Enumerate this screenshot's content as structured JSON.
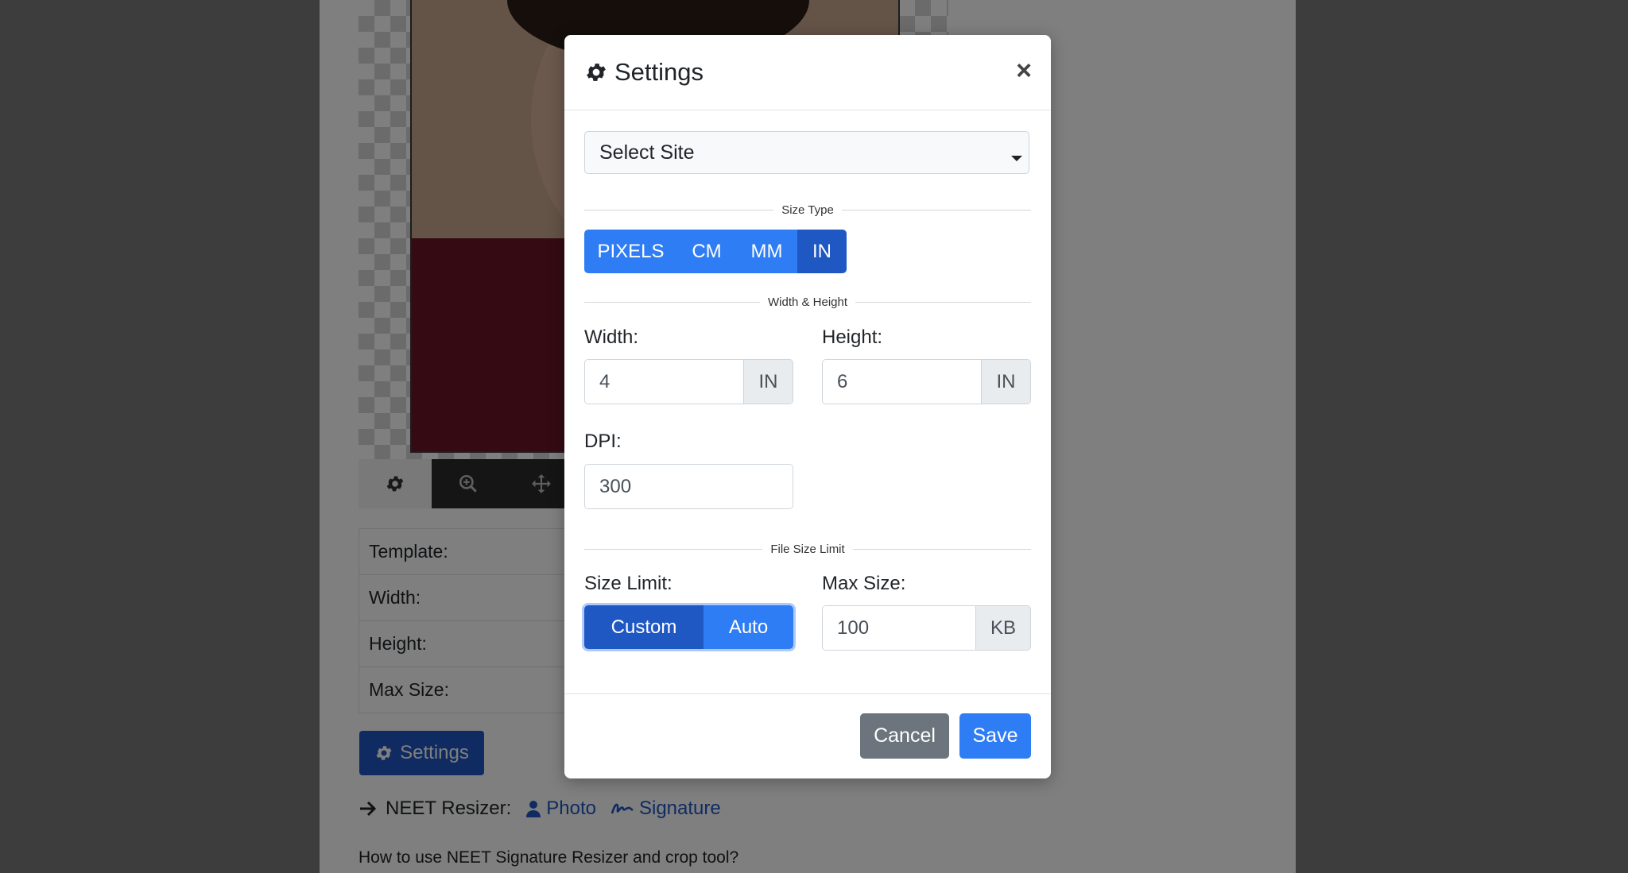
{
  "background": {
    "toolbar_tools": [
      "gear-icon",
      "zoom-in-icon",
      "move-icon"
    ],
    "info_rows": [
      "Template:",
      "Width:",
      "Height:",
      "Max Size:"
    ],
    "settings_button": "Settings",
    "resizer_prefix": "NEET Resizer:",
    "photo_link": "Photo",
    "signature_link": "Signature",
    "howto_text": "How to use NEET Signature Resizer and crop tool?"
  },
  "modal": {
    "title": "Settings",
    "close": "×",
    "select_site": "Select Site",
    "size_type_label": "Size Type",
    "size_types": [
      "PIXELS",
      "CM",
      "MM",
      "IN"
    ],
    "size_type_selected": "IN",
    "width_height_label": "Width & Height",
    "width_label": "Width:",
    "width_value": "4",
    "width_unit": "IN",
    "height_label": "Height:",
    "height_value": "6",
    "height_unit": "IN",
    "dpi_label": "DPI:",
    "dpi_value": "300",
    "file_size_limit_label": "File Size Limit",
    "size_limit_label": "Size Limit:",
    "size_limit_options": [
      "Custom",
      "Auto"
    ],
    "size_limit_selected": "Custom",
    "max_size_label": "Max Size:",
    "max_size_value": "100",
    "max_size_unit": "KB",
    "cancel": "Cancel",
    "save": "Save"
  },
  "colors": {
    "primary": "#2f7df5",
    "primary_active": "#1f57c3",
    "secondary": "#6c757d"
  }
}
